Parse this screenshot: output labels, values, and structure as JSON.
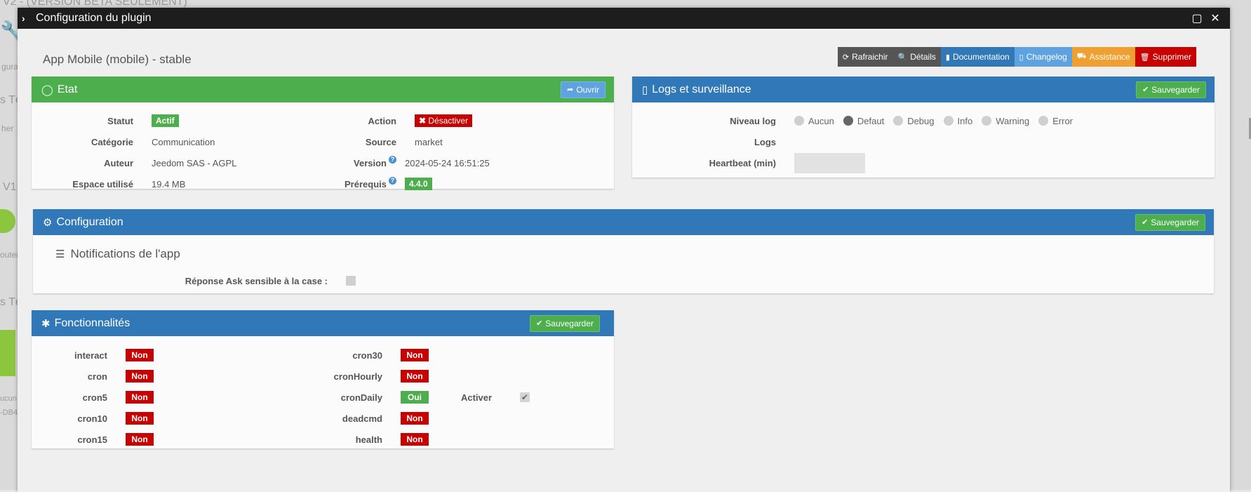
{
  "background": {
    "fragment_top": "V2 - (VERSION BETA SEULEMENT)",
    "fragment_config": "gura",
    "fragment_te1": "s Té",
    "fragment_search": "her",
    "fragment_v1": "V1",
    "fragment_ajouter": "outer",
    "fragment_te2": "s Té",
    "fragment_aucun": "ucun",
    "fragment_db": "-DB4"
  },
  "window": {
    "title": "Configuration du plugin",
    "icons": {
      "collapse": "chevron-right-icon",
      "maximize": "maximize-icon",
      "close": "close-icon"
    }
  },
  "plugin_name": "App Mobile (mobile) - stable",
  "toolbar": [
    {
      "label": "Rafraichir",
      "icon": "refresh-icon",
      "color": "#555555"
    },
    {
      "label": "Détails",
      "icon": "search-icon",
      "color": "#555555"
    },
    {
      "label": "Documentation",
      "icon": "book-icon",
      "color": "#3178b8"
    },
    {
      "label": "Changelog",
      "icon": "file-icon",
      "color": "#5ea3e0"
    },
    {
      "label": "Assistance",
      "icon": "truck-icon",
      "color": "#f0a030"
    },
    {
      "label": "Supprimer",
      "icon": "trash-icon",
      "color": "#c80000"
    }
  ],
  "etat": {
    "title": "Etat",
    "open_label": "Ouvrir",
    "statut_label": "Statut",
    "statut_value": "Actif",
    "categorie_label": "Catégorie",
    "categorie_value": "Communication",
    "auteur_label": "Auteur",
    "auteur_value": "Jeedom SAS - AGPL",
    "espace_label": "Espace utilisé",
    "espace_value": "19.4 MB",
    "action_label": "Action",
    "action_value": "Désactiver",
    "source_label": "Source",
    "source_value": "market",
    "version_label": "Version",
    "version_value": "2024-05-24 16:51:25",
    "prerequis_label": "Prérequis",
    "prerequis_value": "4.4.0"
  },
  "logs": {
    "title": "Logs et surveillance",
    "save_label": "Sauvegarder",
    "niveau_label": "Niveau log",
    "levels": [
      "Aucun",
      "Defaut",
      "Debug",
      "Info",
      "Warning",
      "Error"
    ],
    "selected_level": "Defaut",
    "logs_label": "Logs",
    "heartbeat_label": "Heartbeat (min)",
    "heartbeat_value": ""
  },
  "configuration": {
    "title": "Configuration",
    "save_label": "Sauvegarder",
    "section_title": "Notifications de l'app",
    "ask_label": "Réponse Ask sensible à la case :"
  },
  "fonctionnalites": {
    "title": "Fonctionnalités",
    "save_label": "Sauvegarder",
    "left": [
      {
        "name": "interact",
        "value": "Non"
      },
      {
        "name": "cron",
        "value": "Non"
      },
      {
        "name": "cron5",
        "value": "Non"
      },
      {
        "name": "cron10",
        "value": "Non"
      },
      {
        "name": "cron15",
        "value": "Non"
      }
    ],
    "right": [
      {
        "name": "cron30",
        "value": "Non"
      },
      {
        "name": "cronHourly",
        "value": "Non"
      },
      {
        "name": "cronDaily",
        "value": "Oui"
      },
      {
        "name": "deadcmd",
        "value": "Non"
      },
      {
        "name": "health",
        "value": "Non"
      }
    ],
    "activer_label": "Activer"
  }
}
